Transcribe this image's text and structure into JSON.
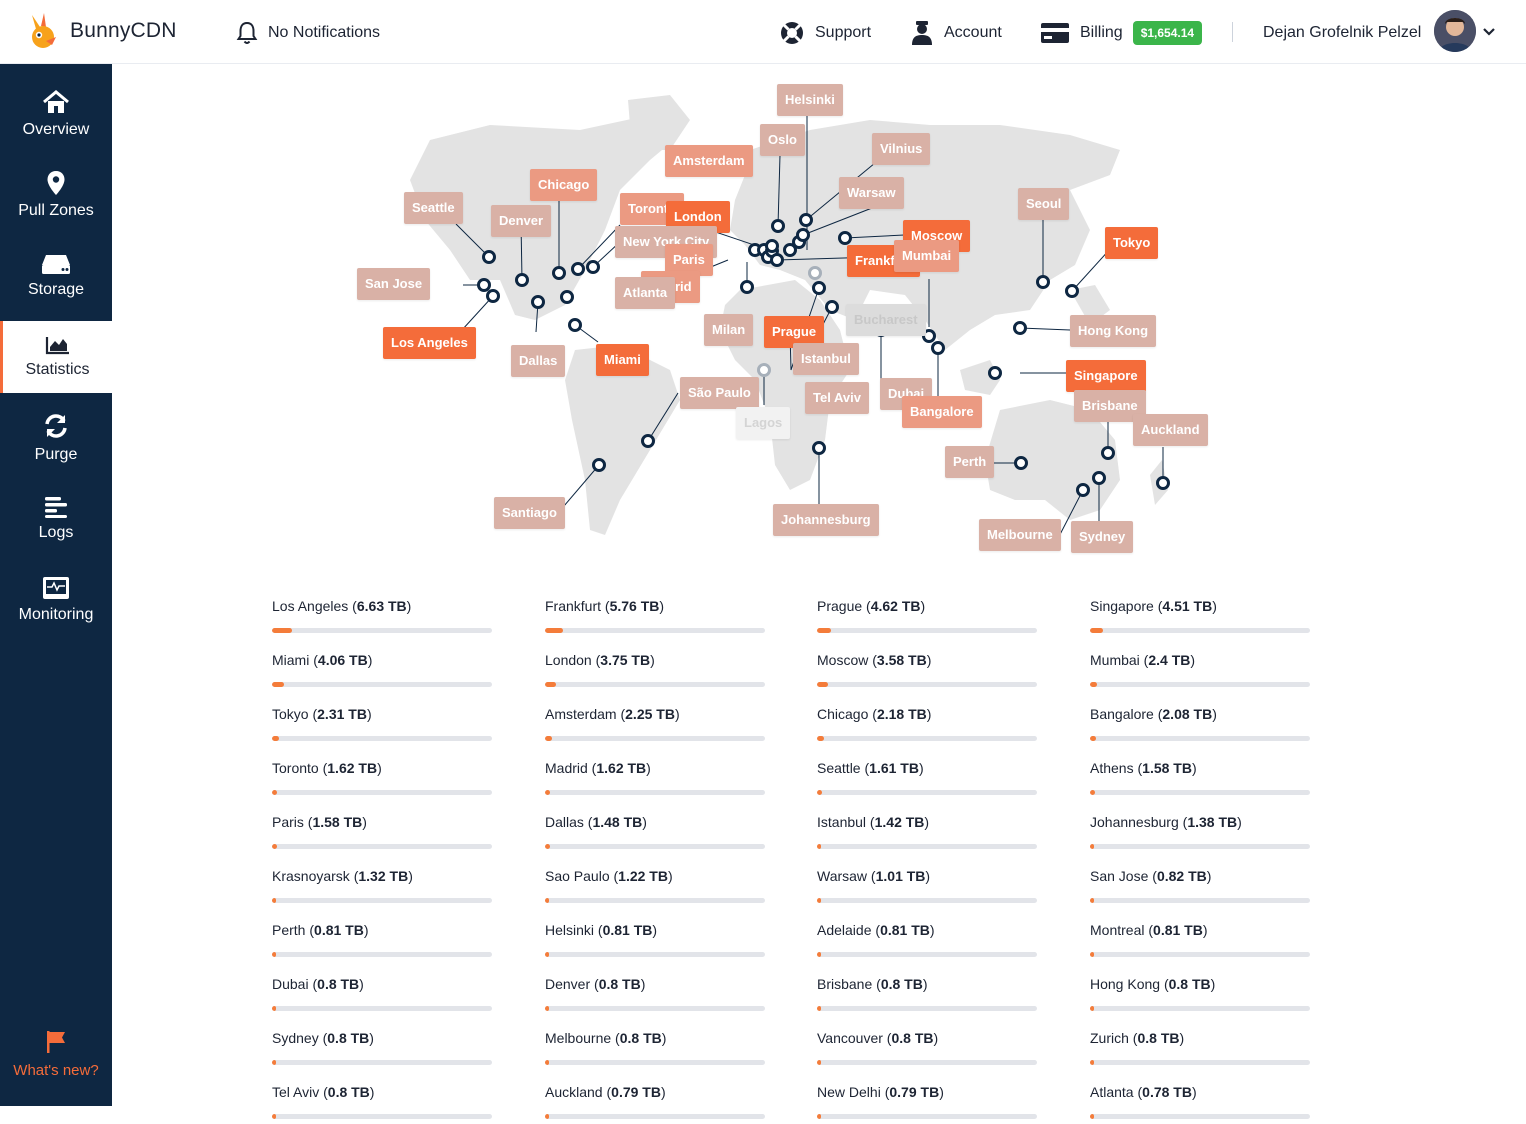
{
  "header": {
    "brand": "BunnyCDN",
    "notifications": "No Notifications",
    "support": "Support",
    "account": "Account",
    "billing": "Billing",
    "balance": "$1,654.14",
    "user_name": "Dejan Grofelnik Pelzel"
  },
  "sidebar": {
    "items": [
      {
        "label": "Overview",
        "icon": "home-icon"
      },
      {
        "label": "Pull Zones",
        "icon": "map-pin-icon"
      },
      {
        "label": "Storage",
        "icon": "storage-icon"
      },
      {
        "label": "Statistics",
        "icon": "chart-icon"
      },
      {
        "label": "Purge",
        "icon": "refresh-icon"
      },
      {
        "label": "Logs",
        "icon": "logs-icon"
      },
      {
        "label": "Monitoring",
        "icon": "monitor-icon"
      }
    ],
    "active": "Statistics",
    "whats_new": "What's new?"
  },
  "colors": {
    "accent": "#f46c3a",
    "sidebar": "#0e2742",
    "success": "#3bb54a",
    "bar_fill": "#f47c3a",
    "label_light": "#d9b1a6",
    "label_hot": "#f46c3a"
  },
  "map": {
    "locations": [
      {
        "name": "Helsinki",
        "status": "active"
      },
      {
        "name": "Oslo",
        "status": "active"
      },
      {
        "name": "Amsterdam",
        "status": "active"
      },
      {
        "name": "Vilnius",
        "status": "active"
      },
      {
        "name": "Seattle",
        "status": "active"
      },
      {
        "name": "Chicago",
        "status": "active"
      },
      {
        "name": "Denver",
        "status": "active"
      },
      {
        "name": "Toronto",
        "status": "active"
      },
      {
        "name": "London",
        "status": "active"
      },
      {
        "name": "Warsaw",
        "status": "active"
      },
      {
        "name": "Seoul",
        "status": "active"
      },
      {
        "name": "Moscow",
        "status": "active"
      },
      {
        "name": "Tokyo",
        "status": "active"
      },
      {
        "name": "New York City",
        "status": "active"
      },
      {
        "name": "Frankfurt",
        "status": "active"
      },
      {
        "name": "Mumbai",
        "status": "active"
      },
      {
        "name": "Paris",
        "status": "active"
      },
      {
        "name": "San Jose",
        "status": "active"
      },
      {
        "name": "Madrid",
        "status": "active"
      },
      {
        "name": "Atlanta",
        "status": "active"
      },
      {
        "name": "Milan",
        "status": "active"
      },
      {
        "name": "Prague",
        "status": "active"
      },
      {
        "name": "Bucharest",
        "status": "inactive"
      },
      {
        "name": "Hong Kong",
        "status": "active"
      },
      {
        "name": "Los Angeles",
        "status": "active"
      },
      {
        "name": "Dallas",
        "status": "active"
      },
      {
        "name": "Miami",
        "status": "active"
      },
      {
        "name": "Istanbul",
        "status": "active"
      },
      {
        "name": "Singapore",
        "status": "active"
      },
      {
        "name": "São Paulo",
        "status": "active"
      },
      {
        "name": "Dubai",
        "status": "active"
      },
      {
        "name": "Tel Aviv",
        "status": "active"
      },
      {
        "name": "Bangalore",
        "status": "active"
      },
      {
        "name": "Brisbane",
        "status": "active"
      },
      {
        "name": "Lagos",
        "status": "inactive"
      },
      {
        "name": "Auckland",
        "status": "active"
      },
      {
        "name": "Perth",
        "status": "active"
      },
      {
        "name": "Santiago",
        "status": "active"
      },
      {
        "name": "Johannesburg",
        "status": "active"
      },
      {
        "name": "Melbourne",
        "status": "active"
      },
      {
        "name": "Sydney",
        "status": "active"
      }
    ]
  },
  "stats": [
    {
      "city": "Los Angeles",
      "value": "6.63 TB",
      "pct": 0.09
    },
    {
      "city": "Frankfurt",
      "value": "5.76 TB",
      "pct": 0.08
    },
    {
      "city": "Prague",
      "value": "4.62 TB",
      "pct": 0.065
    },
    {
      "city": "Singapore",
      "value": "4.51 TB",
      "pct": 0.06
    },
    {
      "city": "Miami",
      "value": "4.06 TB",
      "pct": 0.056
    },
    {
      "city": "London",
      "value": "3.75 TB",
      "pct": 0.052
    },
    {
      "city": "Moscow",
      "value": "3.58 TB",
      "pct": 0.05
    },
    {
      "city": "Mumbai",
      "value": "2.4 TB",
      "pct": 0.034
    },
    {
      "city": "Tokyo",
      "value": "2.31 TB",
      "pct": 0.032
    },
    {
      "city": "Amsterdam",
      "value": "2.25 TB",
      "pct": 0.031
    },
    {
      "city": "Chicago",
      "value": "2.18 TB",
      "pct": 0.03
    },
    {
      "city": "Bangalore",
      "value": "2.08 TB",
      "pct": 0.029
    },
    {
      "city": "Toronto",
      "value": "1.62 TB",
      "pct": 0.023
    },
    {
      "city": "Madrid",
      "value": "1.62 TB",
      "pct": 0.023
    },
    {
      "city": "Seattle",
      "value": "1.61 TB",
      "pct": 0.022
    },
    {
      "city": "Athens",
      "value": "1.58 TB",
      "pct": 0.022
    },
    {
      "city": "Paris",
      "value": "1.58 TB",
      "pct": 0.022
    },
    {
      "city": "Dallas",
      "value": "1.48 TB",
      "pct": 0.021
    },
    {
      "city": "Istanbul",
      "value": "1.42 TB",
      "pct": 0.02
    },
    {
      "city": "Johannesburg",
      "value": "1.38 TB",
      "pct": 0.019
    },
    {
      "city": "Krasnoyarsk",
      "value": "1.32 TB",
      "pct": 0.018
    },
    {
      "city": "Sao Paulo",
      "value": "1.22 TB",
      "pct": 0.017
    },
    {
      "city": "Warsaw",
      "value": "1.01 TB",
      "pct": 0.014
    },
    {
      "city": "San Jose",
      "value": "0.82 TB",
      "pct": 0.012
    },
    {
      "city": "Perth",
      "value": "0.81 TB",
      "pct": 0.011
    },
    {
      "city": "Helsinki",
      "value": "0.81 TB",
      "pct": 0.011
    },
    {
      "city": "Adelaide",
      "value": "0.81 TB",
      "pct": 0.011
    },
    {
      "city": "Montreal",
      "value": "0.81 TB",
      "pct": 0.011
    },
    {
      "city": "Dubai",
      "value": "0.8 TB",
      "pct": 0.011
    },
    {
      "city": "Denver",
      "value": "0.8 TB",
      "pct": 0.011
    },
    {
      "city": "Brisbane",
      "value": "0.8 TB",
      "pct": 0.011
    },
    {
      "city": "Hong Kong",
      "value": "0.8 TB",
      "pct": 0.011
    },
    {
      "city": "Sydney",
      "value": "0.8 TB",
      "pct": 0.011
    },
    {
      "city": "Melbourne",
      "value": "0.8 TB",
      "pct": 0.011
    },
    {
      "city": "Vancouver",
      "value": "0.8 TB",
      "pct": 0.011
    },
    {
      "city": "Zurich",
      "value": "0.8 TB",
      "pct": 0.011
    },
    {
      "city": "Tel Aviv",
      "value": "0.8 TB",
      "pct": 0.011
    },
    {
      "city": "Auckland",
      "value": "0.79 TB",
      "pct": 0.011
    },
    {
      "city": "New Delhi",
      "value": "0.79 TB",
      "pct": 0.011
    },
    {
      "city": "Atlanta",
      "value": "0.78 TB",
      "pct": 0.011
    }
  ]
}
